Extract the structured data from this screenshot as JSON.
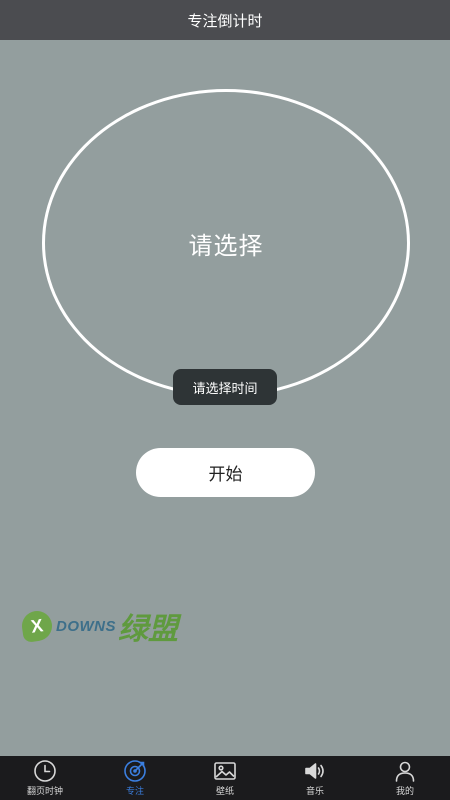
{
  "header": {
    "title": "专注倒计时"
  },
  "timer": {
    "label": "请选择"
  },
  "toast": {
    "text": "请选择时间"
  },
  "start_button": {
    "label": "开始"
  },
  "watermark": {
    "badge": "X",
    "brand": "DOWNS",
    "brand_cn": "绿盟"
  },
  "tabs": [
    {
      "label": "翻页时钟",
      "icon": "clock-icon",
      "active": false
    },
    {
      "label": "专注",
      "icon": "focus-target-icon",
      "active": true
    },
    {
      "label": "壁纸",
      "icon": "image-icon",
      "active": false
    },
    {
      "label": "音乐",
      "icon": "speaker-icon",
      "active": false
    },
    {
      "label": "我的",
      "icon": "person-icon",
      "active": false
    }
  ],
  "colors": {
    "background": "#939e9e",
    "header_bg": "#4b4c50",
    "tabbar_bg": "#1b1b1d",
    "accent": "#3b7fe0",
    "toast_bg": "#2e3436"
  }
}
